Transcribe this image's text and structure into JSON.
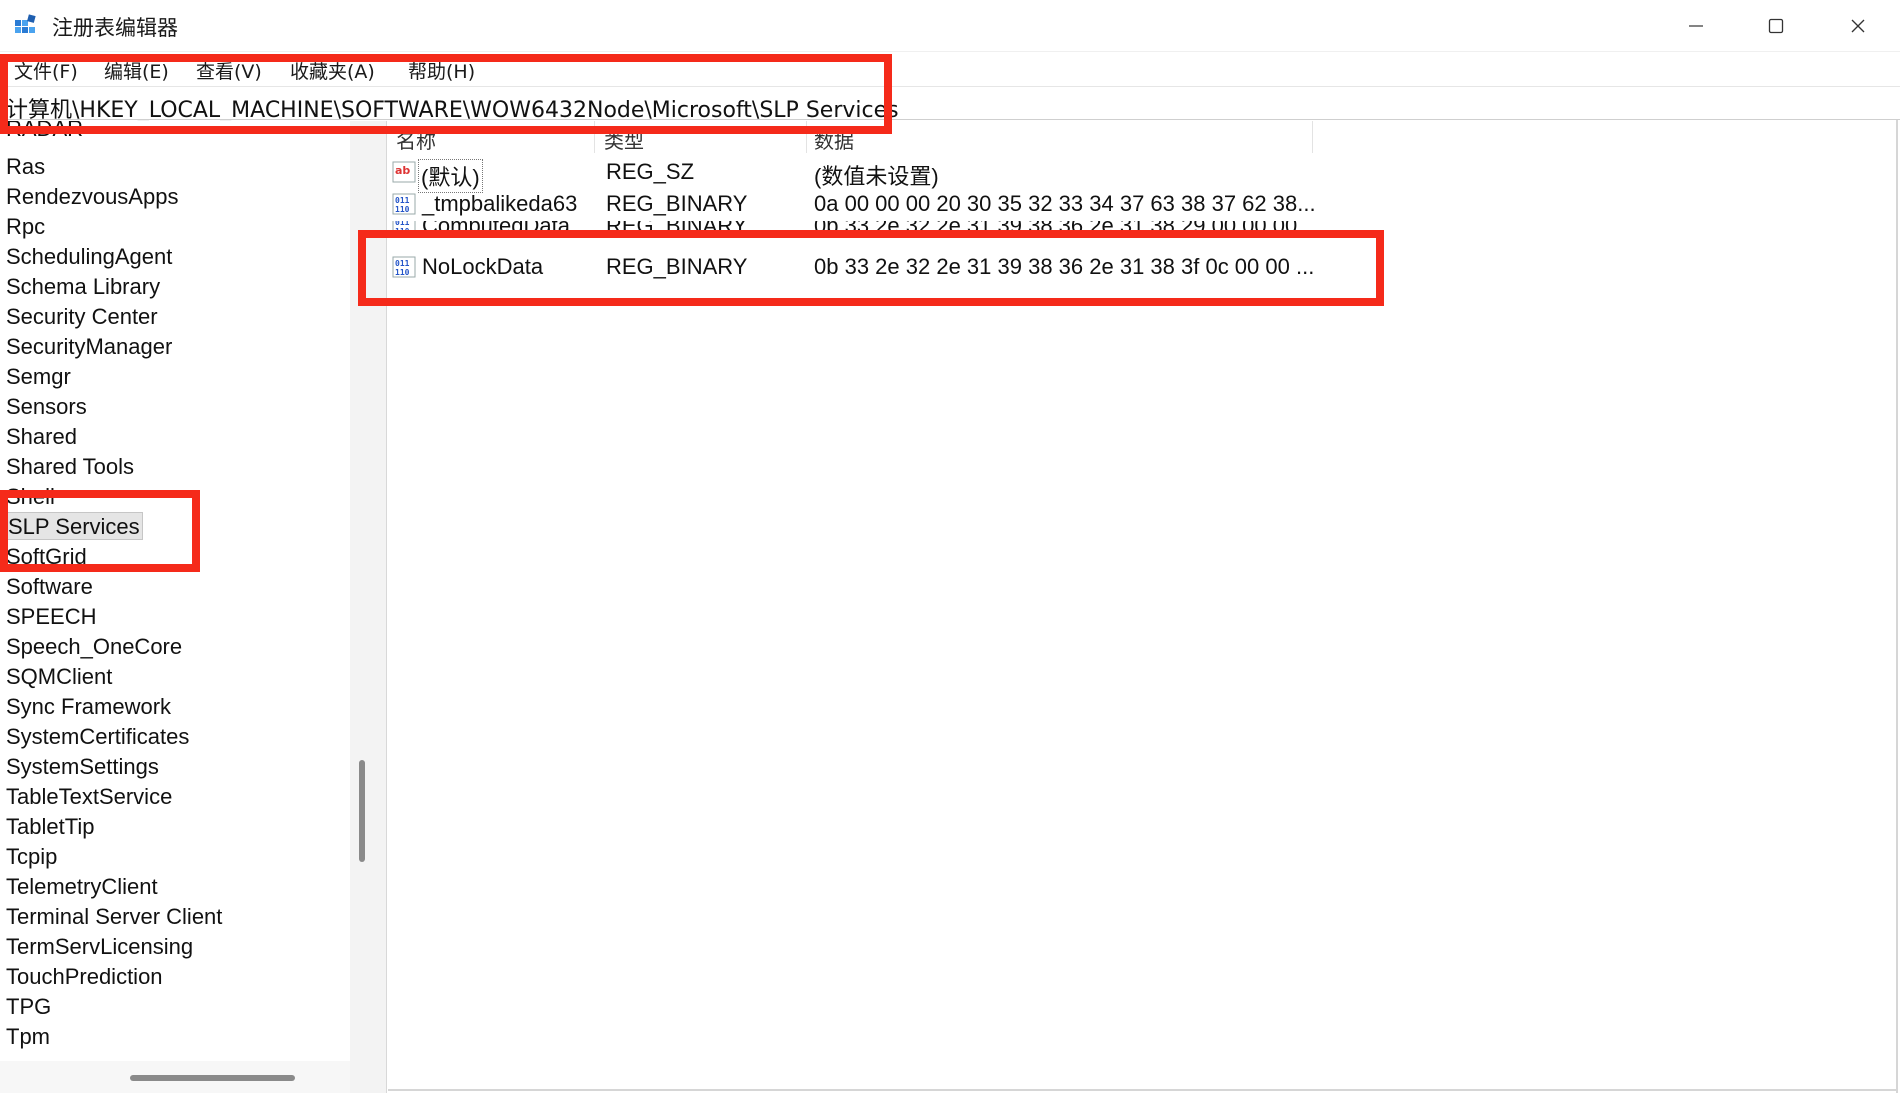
{
  "window": {
    "title": "注册表编辑器",
    "app_icon": "registry-editor-icon",
    "controls": [
      "minimize-icon",
      "maximize-icon",
      "close-icon"
    ]
  },
  "menu": [
    "文件(F)",
    "编辑(E)",
    "查看(V)",
    "收藏夹(A)",
    "帮助(H)"
  ],
  "address": "计算机\\HKEY_LOCAL_MACHINE\\SOFTWARE\\WOW6432Node\\Microsoft\\SLP Services",
  "tree": {
    "items": [
      "RADAR",
      "Ras",
      "RendezvousApps",
      "Rpc",
      "SchedulingAgent",
      "Schema Library",
      "Security Center",
      "SecurityManager",
      "Semgr",
      "Sensors",
      "Shared",
      "Shared Tools",
      "Shell",
      "SLP Services",
      "SoftGrid",
      "Software",
      "SPEECH",
      "Speech_OneCore",
      "SQMClient",
      "Sync Framework",
      "SystemCertificates",
      "SystemSettings",
      "TableTextService",
      "TabletTip",
      "Tcpip",
      "TelemetryClient",
      "Terminal Server Client",
      "TermServLicensing",
      "TouchPrediction",
      "TPG",
      "Tpm"
    ],
    "selected": "SLP Services"
  },
  "values": {
    "columns": [
      "名称",
      "类型",
      "数据"
    ],
    "rows": [
      {
        "icon": "string-value-icon",
        "name": "(默认)",
        "type": "REG_SZ",
        "data": "(数值未设置)"
      },
      {
        "icon": "binary-value-icon",
        "name": "_tmpbalikeda63",
        "type": "REG_BINARY",
        "data": "0a 00 00 00 20 30 35 32 33 34 37 63 38 37 62 38..."
      },
      {
        "icon": "binary-value-icon",
        "name": "ComputedData...",
        "type": "REG_BINARY",
        "data": "0b 33 2e 32 2e 31 39 38 36 2e 31 38 29 00 00 00..."
      },
      {
        "icon": "binary-value-icon",
        "name": "NoLockData",
        "type": "REG_BINARY",
        "data": "0b 33 2e 32 2e 31 39 38 36 2e 31 38 3f 0c 00 00 ..."
      }
    ]
  },
  "colors": {
    "highlight": "#f52a1a",
    "selection": "#e5e5e5"
  }
}
